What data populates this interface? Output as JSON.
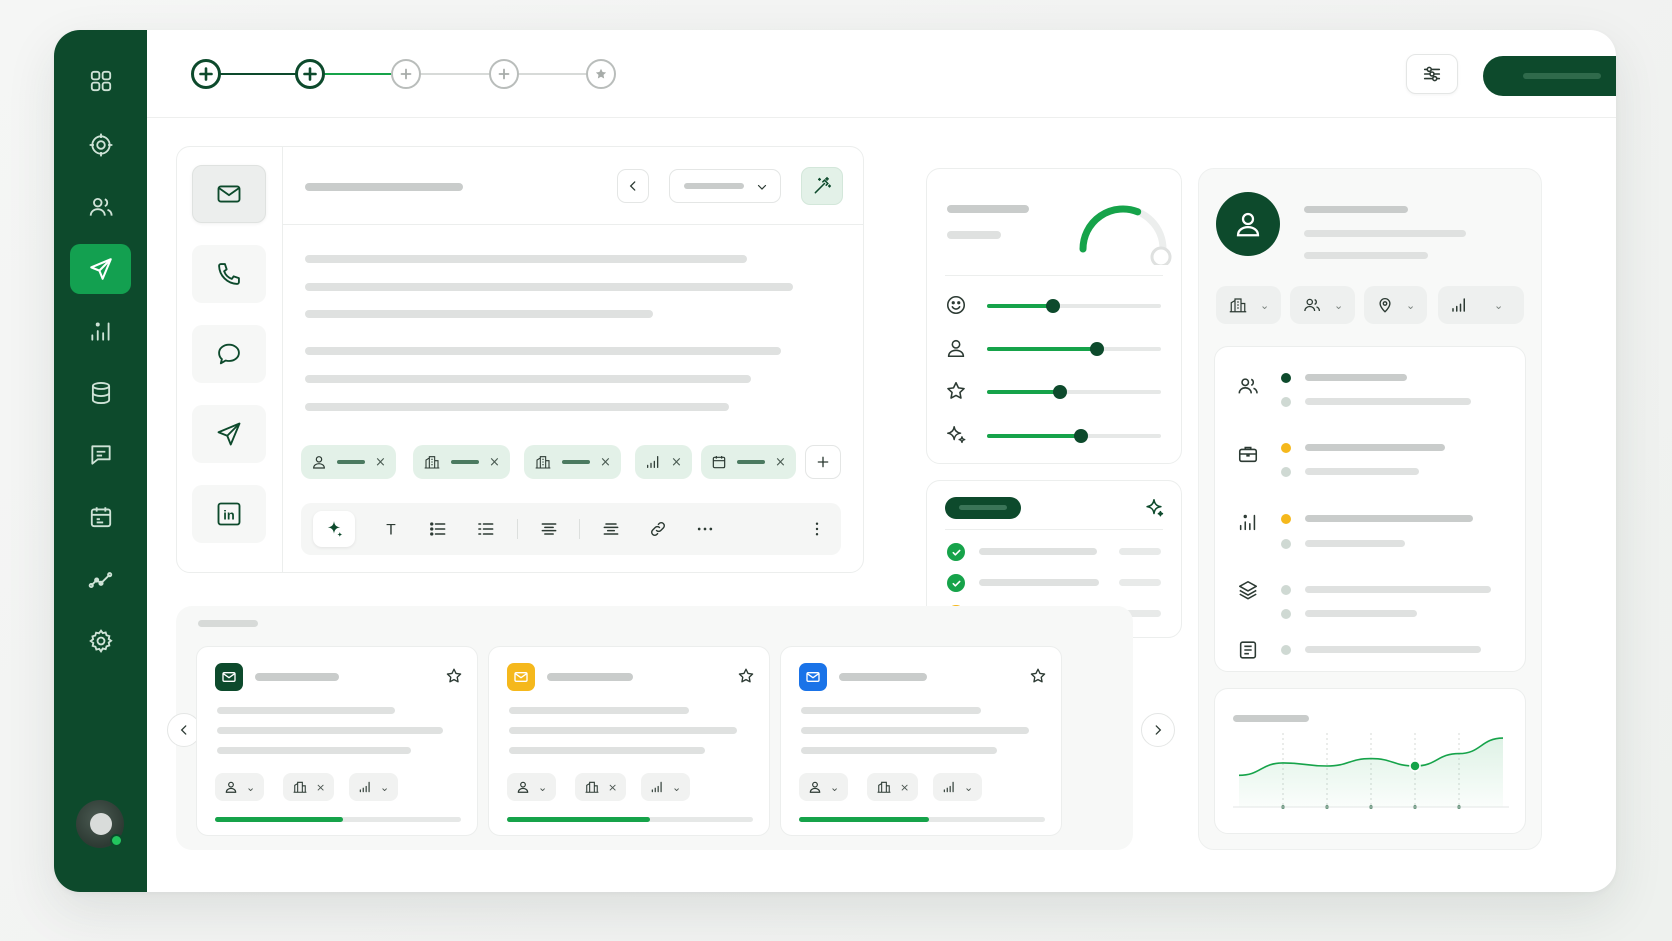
{
  "theme": {
    "primary": "#0d4a2c",
    "accent": "#16a34a",
    "accent_light": "#e3f1e8",
    "warning": "#f5b81c",
    "info": "#1a73e8"
  },
  "sidebar": {
    "items": [
      {
        "name": "grid-icon",
        "active": false
      },
      {
        "name": "target-icon",
        "active": false
      },
      {
        "name": "users-icon",
        "active": false
      },
      {
        "name": "send-icon",
        "active": true
      },
      {
        "name": "bar-chart-icon",
        "active": false
      },
      {
        "name": "database-icon",
        "active": false
      },
      {
        "name": "message-square-icon",
        "active": false
      },
      {
        "name": "calendar-icon",
        "active": false
      },
      {
        "name": "trend-line-icon",
        "active": false
      },
      {
        "name": "settings-icon",
        "active": false
      }
    ],
    "user_status": "online"
  },
  "stepper": {
    "steps": [
      {
        "icon": "plus-icon",
        "state": "completed"
      },
      {
        "icon": "plus-icon",
        "state": "completed"
      },
      {
        "icon": "plus-icon",
        "state": "pending"
      },
      {
        "icon": "plus-icon",
        "state": "pending"
      },
      {
        "icon": "star-icon",
        "state": "pending"
      }
    ]
  },
  "composer": {
    "channels": [
      {
        "name": "mail-icon",
        "active": true
      },
      {
        "name": "phone-icon",
        "active": false
      },
      {
        "name": "chat-bubble-icon",
        "active": false
      },
      {
        "name": "send-icon",
        "active": false
      },
      {
        "name": "linkedin-icon",
        "active": false
      }
    ],
    "linkedin_glyph": "in",
    "tags": [
      {
        "icon": "user-icon",
        "remove": "×"
      },
      {
        "icon": "building-icon",
        "remove": "×"
      },
      {
        "icon": "building-icon",
        "remove": "×"
      },
      {
        "icon": "signal-icon",
        "remove": "×"
      },
      {
        "icon": "calendar-icon",
        "remove": "×"
      }
    ],
    "toolbar": [
      "sparkle-icon",
      "text-icon",
      "list-icon",
      "list-icon",
      "align-center-icon",
      "align-center-icon",
      "link-icon",
      "more-horizontal-icon",
      "more-vertical-icon"
    ],
    "format_text_glyph": "T"
  },
  "sliders": {
    "gauge_fraction": 0.62,
    "rows": [
      {
        "icon": "smile-icon",
        "value": 0.38
      },
      {
        "icon": "user-icon",
        "value": 0.63
      },
      {
        "icon": "star-icon",
        "value": 0.42
      },
      {
        "icon": "sparkles-icon",
        "value": 0.54
      }
    ]
  },
  "checklist": {
    "items": [
      {
        "status": "done",
        "color": "#16a34a"
      },
      {
        "status": "done",
        "color": "#16a34a"
      },
      {
        "status": "warning",
        "color": "#f5b81c"
      }
    ]
  },
  "templates": [
    {
      "badge_color": "#0d4a2c",
      "progress": 0.52,
      "chips": [
        "user-icon",
        "building-icon",
        "signal-icon"
      ]
    },
    {
      "badge_color": "#f5b81c",
      "progress": 0.58,
      "chips": [
        "user-icon",
        "building-icon",
        "signal-icon"
      ]
    },
    {
      "badge_color": "#1a73e8",
      "progress": 0.53,
      "chips": [
        "user-icon",
        "building-icon",
        "signal-icon"
      ]
    }
  ],
  "chip_glyphs": {
    "remove": "×",
    "chevron": "⌄"
  },
  "profile": {
    "filters": [
      "building-icon",
      "users-icon",
      "map-pin-icon",
      "signal-icon"
    ],
    "details": [
      {
        "icon": "users-icon",
        "dot": "#0d4a2c"
      },
      {
        "icon": "briefcase-icon",
        "dot": "#f5b81c"
      },
      {
        "icon": "bar-chart-icon",
        "dot": "#f5b81c"
      },
      {
        "icon": "layers-icon",
        "dot": "#cfd9d3"
      },
      {
        "icon": "document-icon",
        "dot": "#cfd9d3"
      }
    ]
  },
  "chart_data": {
    "type": "area",
    "x": [
      0,
      1,
      2,
      3,
      4,
      5,
      6
    ],
    "values": [
      0.35,
      0.55,
      0.5,
      0.62,
      0.5,
      0.7,
      0.95
    ],
    "highlight_index": 4,
    "ylim": [
      0,
      1
    ],
    "grid": "vertical dashed",
    "title": "",
    "xlabel": "",
    "ylabel": ""
  }
}
